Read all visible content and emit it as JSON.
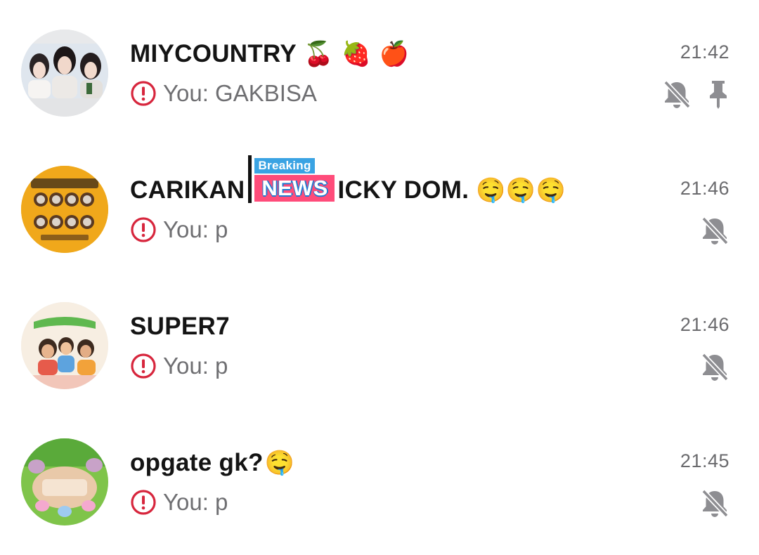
{
  "colors": {
    "error": "#d7263d",
    "muted_icon": "#8e8e92",
    "time": "#6a6a6d",
    "preview": "#6f6f72"
  },
  "chats": [
    {
      "title": "MIYCOUNTRY",
      "title_emoji": "🍒 🍓 🍎",
      "preview": "You: GAKBISA",
      "time": "21:42",
      "muted": true,
      "pinned": true,
      "failed": true
    },
    {
      "title_before": "CARIKAN",
      "sticker_top": "Breaking",
      "sticker_main": "NEWS",
      "title_after": "ICKY DOM.",
      "title_emoji": "🤤🤤🤤",
      "preview": "You: p",
      "time": "21:46",
      "muted": true,
      "failed": true
    },
    {
      "title": "SUPER7",
      "preview": "You: p",
      "time": "21:46",
      "muted": true,
      "failed": true
    },
    {
      "title": "opgate gk?",
      "title_emoji": "🤤",
      "preview": "You: p",
      "time": "21:45",
      "muted": true,
      "failed": true
    }
  ]
}
